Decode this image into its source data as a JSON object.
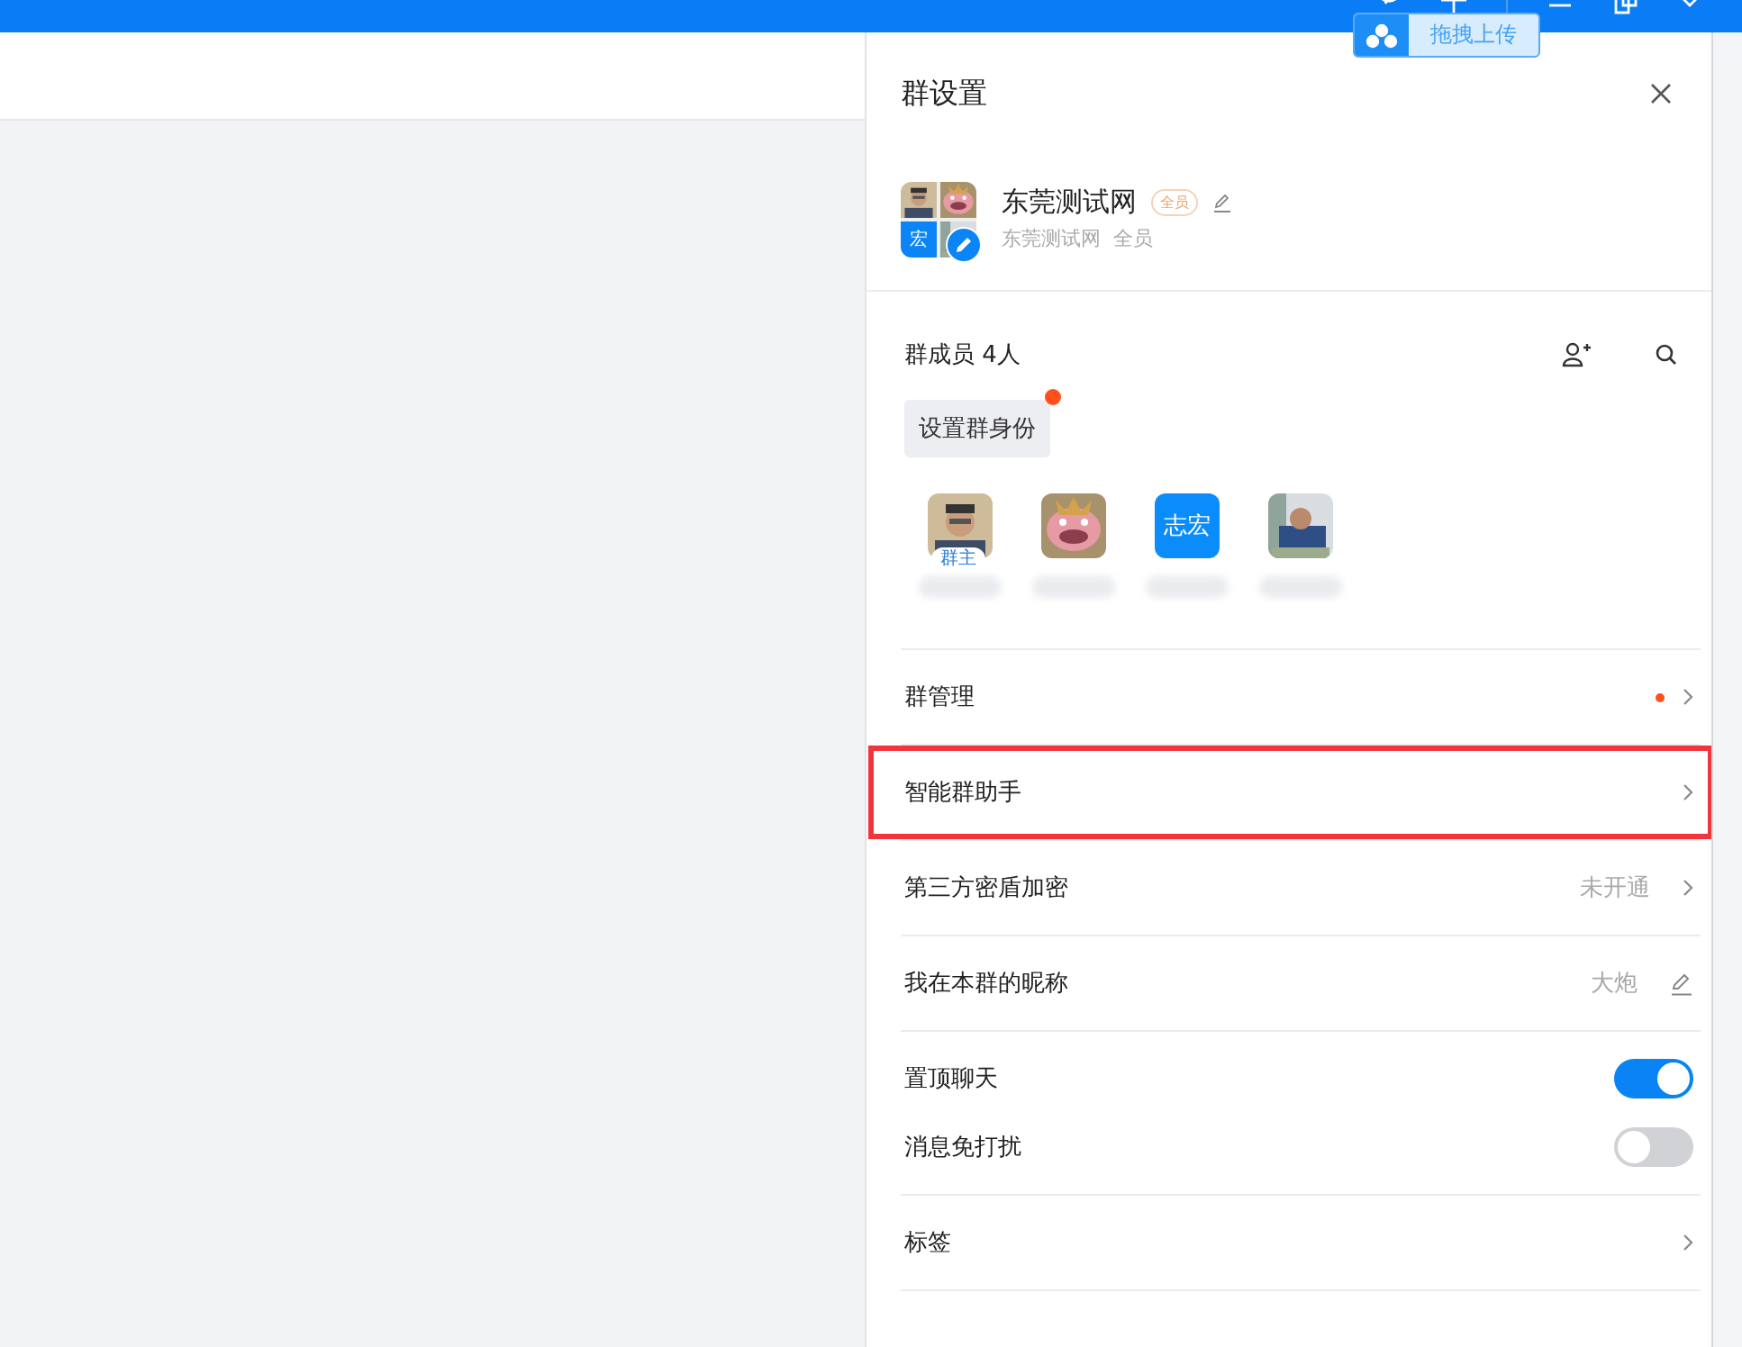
{
  "upload_badge": {
    "label": "拖拽上传"
  },
  "panel": {
    "title": "群设置"
  },
  "group": {
    "name": "东莞测试网",
    "badge": "全员",
    "subtitle": "东莞测试网  全员",
    "avatar_tile": "宏"
  },
  "members": {
    "title": "群成员 4人",
    "role_button": {
      "label": "设置群身份",
      "notification": true
    },
    "list": [
      {
        "kind": "picture",
        "tag": "群主"
      },
      {
        "kind": "picture"
      },
      {
        "kind": "text",
        "initials": "志宏"
      },
      {
        "kind": "picture"
      }
    ]
  },
  "rows": [
    {
      "kind": "link",
      "label": "群管理",
      "notification": true
    },
    {
      "kind": "link",
      "label": "智能群助手",
      "highlighted": true
    },
    {
      "kind": "link",
      "label": "第三方密盾加密",
      "value": "未开通"
    },
    {
      "kind": "edit",
      "label": "我在本群的昵称",
      "value": "大炮"
    },
    {
      "kind": "toggle",
      "label": "置顶聊天",
      "on": true
    },
    {
      "kind": "toggle",
      "label": "消息免打扰",
      "on": false
    },
    {
      "kind": "link",
      "label": "标签"
    }
  ]
}
